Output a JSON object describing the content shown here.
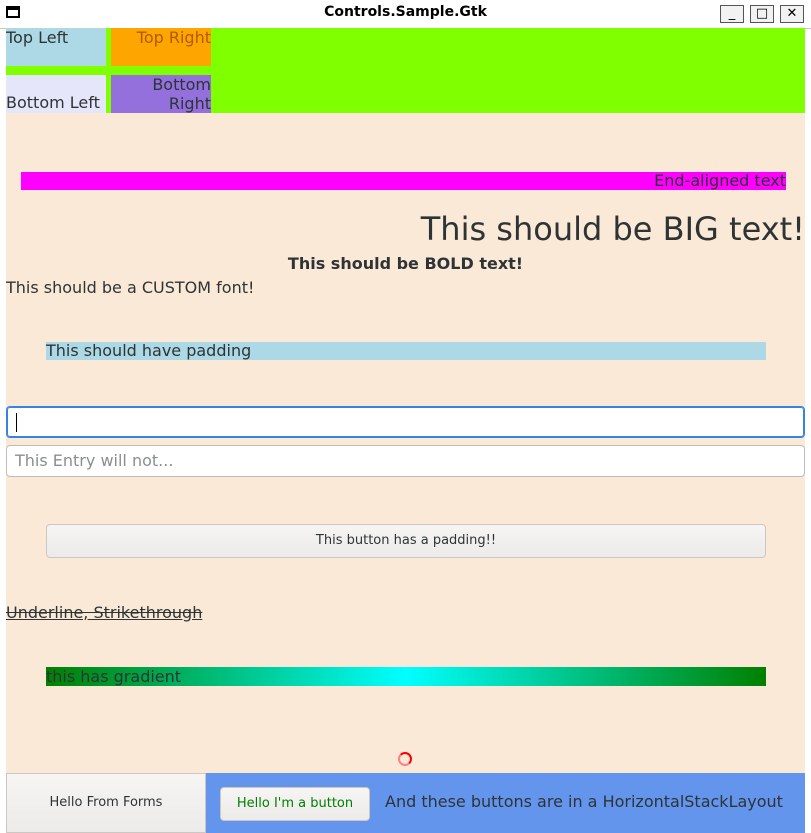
{
  "window": {
    "title": "Controls.Sample.Gtk",
    "controls": {
      "minimize": "_",
      "maximize": "□",
      "close": "✕"
    }
  },
  "grid": {
    "top_left": "Top Left",
    "top_right": "Top Right",
    "bottom_left": "Bottom Left",
    "bottom_right": "Bottom Right"
  },
  "labels": {
    "end_aligned": "End-aligned text",
    "big": "This should be BIG text!",
    "bold": "This should be BOLD text!",
    "custom_font": "This should be a CUSTOM font!",
    "padding": "This should have padding",
    "decorations": "Underline, Strikethrough",
    "gradient": "this has gradient"
  },
  "entries": {
    "focused_value": "",
    "disabled_placeholder": "This Entry will not..."
  },
  "buttons": {
    "padding": "This button has a padding!!",
    "hello_forms": "Hello From Forms",
    "hello_button": "Hello I'm a button"
  },
  "horizontal_stack": {
    "label": "And these buttons are in a HorizontalStackLayout"
  },
  "colors": {
    "grid_background": "#80ff00",
    "top_left": "#add8e6",
    "top_right": "#ffa500",
    "bottom_left": "#e6e6fa",
    "bottom_right": "#9370db",
    "page_background": "#fae9d6",
    "end_bar": "#ff00ff",
    "padding_bg": "#add8e6",
    "gradient": [
      "#008000",
      "#00ffff",
      "#008000"
    ],
    "hs_background": "#6495ed",
    "green_text": "#008000"
  }
}
